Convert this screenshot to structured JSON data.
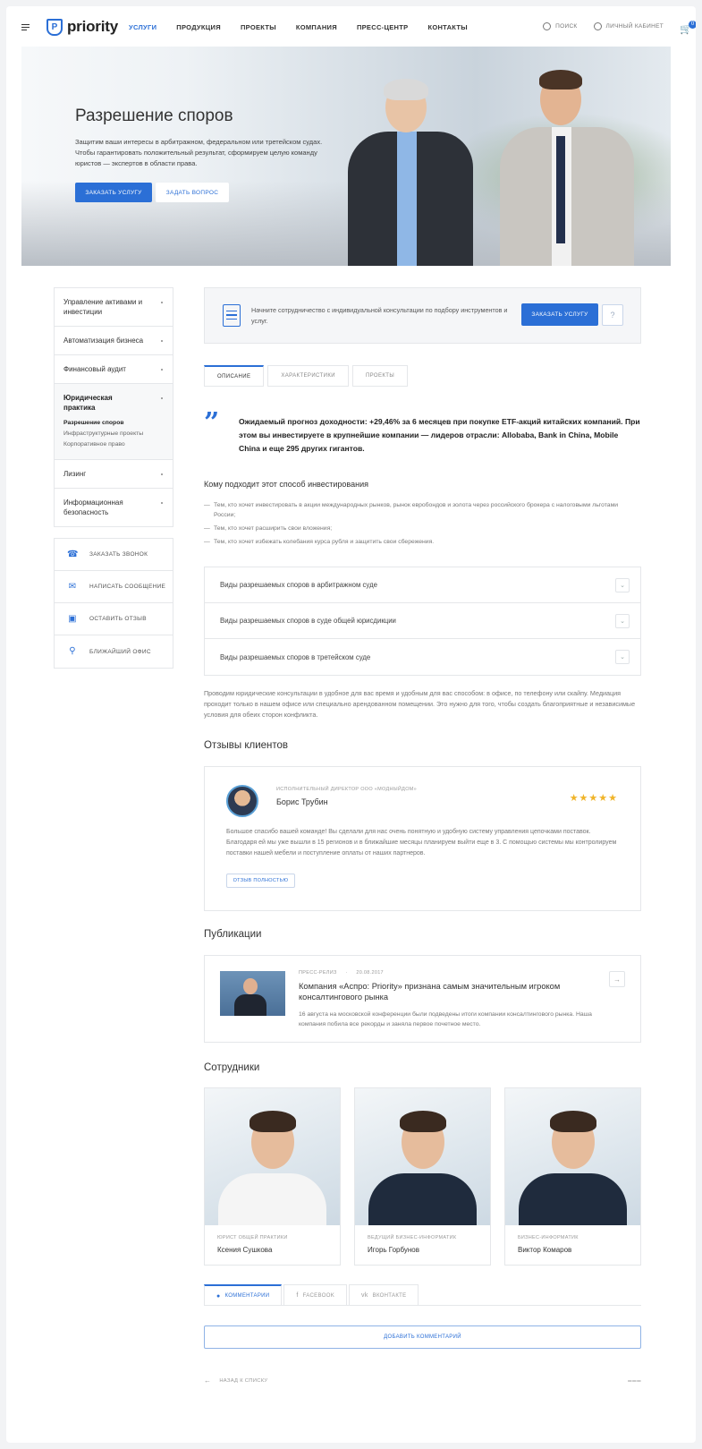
{
  "header": {
    "logo_text": "priority",
    "nav": [
      {
        "label": "УСЛУГИ",
        "active": true
      },
      {
        "label": "ПРОДУКЦИЯ",
        "active": false
      },
      {
        "label": "ПРОЕКТЫ",
        "active": false
      },
      {
        "label": "КОМПАНИЯ",
        "active": false
      },
      {
        "label": "ПРЕСС-ЦЕНТР",
        "active": false
      },
      {
        "label": "КОНТАКТЫ",
        "active": false
      }
    ],
    "search_label": "ПОИСК",
    "account_label": "ЛИЧНЫЙ КАБИНЕТ",
    "cart_count": "0"
  },
  "hero": {
    "title": "Разрешение споров",
    "text": "Защитим ваши интересы в арбитражном, федеральном или третейском судах. Чтобы гарантировать положительный результат, сформируем целую команду юристов — экспертов в области права.",
    "order_button": "ЗАКАЗАТЬ УСЛУГУ",
    "ask_button": "ЗАДАТЬ ВОПРОС"
  },
  "sidebar": {
    "menu": [
      {
        "label": "Управление активами и инвестиции"
      },
      {
        "label": "Автоматизация бизнеса"
      },
      {
        "label": "Финансовый аудит"
      },
      {
        "label": "Юридическая практика",
        "sub": [
          "Разрешение споров",
          "Инфраструктурные проекты",
          "Корпоративное право"
        ]
      },
      {
        "label": "Лизинг"
      },
      {
        "label": "Информационная безопасность"
      }
    ],
    "actions": [
      {
        "label": "ЗАКАЗАТЬ ЗВОНОК",
        "icon": "phone-icon"
      },
      {
        "label": "НАПИСАТЬ СООБЩЕНИЕ",
        "icon": "mail-icon"
      },
      {
        "label": "ОСТАВИТЬ ОТЗЫВ",
        "icon": "chat-icon"
      },
      {
        "label": "БЛИЖАЙШИЙ ОФИС",
        "icon": "location-icon"
      }
    ]
  },
  "consult": {
    "text": "Начните сотрудничество с индивидуальной консультации по подбору инструментов и услуг.",
    "button": "ЗАКАЗАТЬ УСЛУГУ",
    "help": "?"
  },
  "tabs": [
    "ОПИСАНИЕ",
    "ХАРАКТЕРИСТИКИ",
    "ПРОЕКТЫ"
  ],
  "quote": "Ожидаемый прогноз доходности: +29,46% за 6 месяцев при покупке ETF-акций китайских компаний. При этом вы инвестируете в крупнейшие компании — лидеров отрасли: Allobaba, Bank in China, Mobile China и еще 295 других гигантов.",
  "who": {
    "title": "Кому подходит этот способ инвестирования",
    "items": [
      "Тем, кто хочет инвестировать в акции международных рынков, рынок евробондов и золота через российского брокера с налоговыми льготами России;",
      "Тем, кто хочет расширить свои вложения;",
      "Тем, кто хочет избежать колебания курса рубля и защитить свои сбережения."
    ]
  },
  "accordion": [
    "Виды разрешаемых споров в арбитражном суде",
    "Виды разрешаемых споров в суде общей юрисдикции",
    "Виды разрешаемых споров в третейском суде"
  ],
  "paragraph": "Проводим юридические консультации в удобное для вас время и удобным для вас способом: в офисе, по телефону или скайпу. Медиация проходит только в нашем офисе или специально арендованном помещении. Это нужно для того, чтобы создать благоприятные и независимые условия для обеих сторон конфликта.",
  "reviews": {
    "title": "Отзывы клиентов",
    "role": "ИСПОЛНИТЕЛЬНЫЙ ДИРЕКТОР ООО «МОДНЫЙДОМ»",
    "name": "Борис Трубин",
    "stars": "★★★★★",
    "rating": 5,
    "text": "Большое спасибо вашей команде! Вы сделали для нас очень понятную и удобную систему управления цепочками поставок. Благодаря ей мы уже вышли в 15 регионов и в ближайшие месяцы планируем выйти еще в 3. С помощью системы мы контролируем поставки нашей мебели и поступление оплаты от наших партнеров.",
    "button": "ОТЗЫВ ПОЛНОСТЬЮ"
  },
  "publications": {
    "title": "Публикации",
    "type": "ПРЕСС-РЕЛИЗ",
    "date": "20.08.2017",
    "headline": "Компания «Аспро: Priority» признана самым значительным игроком консалтингового рынка",
    "text": "16 августа на московской конференции были подведены итоги компании консалтингового рынка. Наша компания побила все рекорды и заняла первое почетное место."
  },
  "staff": {
    "title": "Сотрудники",
    "people": [
      {
        "role": "ЮРИСТ ОБЩЕЙ ПРАКТИКИ",
        "name": "Ксения Сушкова"
      },
      {
        "role": "ВЕДУЩИЙ БИЗНЕС-ИНФОРМАТИК",
        "name": "Игорь Горбунов"
      },
      {
        "role": "БИЗНЕС-ИНФОРМАТИК",
        "name": "Виктор Комаров"
      }
    ]
  },
  "comments": {
    "tabs": [
      "КОММЕНТАРИИ",
      "FACEBOOK",
      "ВКОНТАКТЕ"
    ],
    "add_button": "ДОБАВИТЬ КОММЕНТАРИЙ"
  },
  "footer": {
    "back": "НАЗАД К СПИСКУ"
  },
  "colors": {
    "accent": "#2b6fd6",
    "star": "#f0b429"
  }
}
